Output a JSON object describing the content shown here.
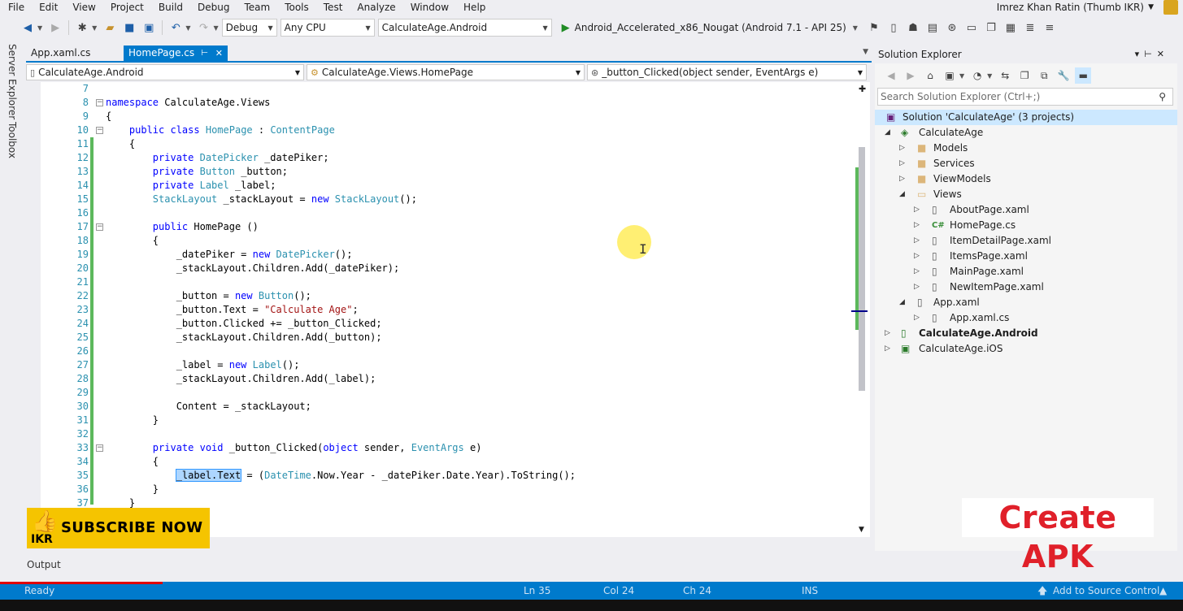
{
  "menu": [
    "File",
    "Edit",
    "View",
    "Project",
    "Build",
    "Debug",
    "Team",
    "Tools",
    "Test",
    "Analyze",
    "Window",
    "Help"
  ],
  "user": "Imrez Khan Ratin (Thumb IKR)",
  "toolbar": {
    "config": "Debug",
    "platform": "Any CPU",
    "startup_project": "CalculateAge.Android",
    "run_target": "Android_Accelerated_x86_Nougat (Android 7.1 - API 25)"
  },
  "left_tabs": [
    "Server Explorer",
    "Toolbox"
  ],
  "doc_tabs": {
    "tab1": "App.xaml.cs",
    "tab2": "HomePage.cs",
    "pin": "⊢",
    "close": "✕"
  },
  "navbar": {
    "project": "CalculateAge.Android",
    "class": "CalculateAge.Views.HomePage",
    "member": "_button_Clicked(object sender, EventArgs e)"
  },
  "code": {
    "line_numbers": [
      "7",
      "8",
      "9",
      "10",
      "11",
      "12",
      "13",
      "14",
      "15",
      "16",
      "17",
      "18",
      "19",
      "20",
      "21",
      "22",
      "23",
      "24",
      "25",
      "26",
      "27",
      "28",
      "29",
      "30",
      "31",
      "32",
      "33",
      "34",
      "35",
      "36",
      "37"
    ]
  },
  "solution_explorer": {
    "title": "Solution Explorer",
    "search_placeholder": "Search Solution Explorer (Ctrl+;)",
    "items": [
      {
        "label": "Solution 'CalculateAge' (3 projects)"
      },
      {
        "label": "CalculateAge"
      },
      {
        "label": "Models"
      },
      {
        "label": "Services"
      },
      {
        "label": "ViewModels"
      },
      {
        "label": "Views"
      },
      {
        "label": "AboutPage.xaml"
      },
      {
        "label": "HomePage.cs"
      },
      {
        "label": "ItemDetailPage.xaml"
      },
      {
        "label": "ItemsPage.xaml"
      },
      {
        "label": "MainPage.xaml"
      },
      {
        "label": "NewItemPage.xaml"
      },
      {
        "label": "App.xaml"
      },
      {
        "label": "App.xaml.cs"
      },
      {
        "label": "CalculateAge.Android"
      },
      {
        "label": "CalculateAge.iOS"
      }
    ]
  },
  "overlays": {
    "subscribe": "SUBSCRIBE NOW",
    "brand": "IKR",
    "create_apk": "Create APK"
  },
  "output_tab": "Output",
  "status": {
    "ready": "Ready",
    "ln": "Ln 35",
    "col": "Col 24",
    "ch": "Ch 24",
    "mode": "INS",
    "source_control": "Add to Source Control"
  },
  "colors": {
    "accent": "#007acc",
    "keyword": "#0000ff",
    "type": "#2b91af",
    "string": "#a31515",
    "subscribe_bg": "#f5c400",
    "create_apk": "#e0202a"
  }
}
